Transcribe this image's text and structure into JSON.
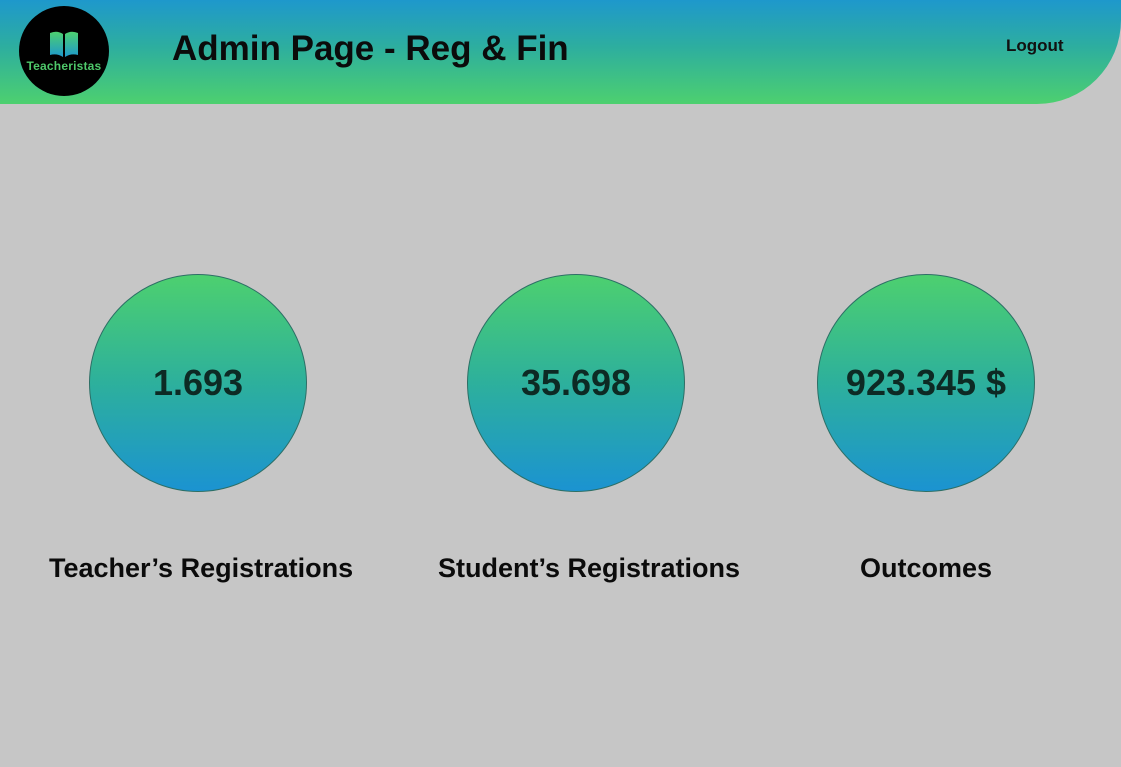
{
  "header": {
    "logo_text": "Teacheristas",
    "logo_icon": "book-icon",
    "title": "Admin Page - Reg & Fin",
    "logout_label": "Logout"
  },
  "stats": [
    {
      "value": "1.693",
      "label": "Teacher’s Registrations"
    },
    {
      "value": "35.698",
      "label": "Student’s Registrations"
    },
    {
      "value": "923.345 $",
      "label": "Outcomes"
    }
  ],
  "colors": {
    "background": "#c6c6c6",
    "gradient_green": "#4dd06f",
    "gradient_blue": "#1e98cc",
    "logo_background": "#000000",
    "logo_text": "#4ec86a"
  }
}
